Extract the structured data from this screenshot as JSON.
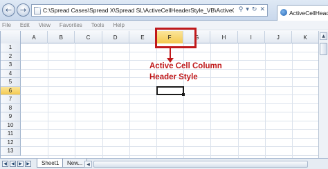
{
  "browser": {
    "url": "C:\\Spread Cases\\Spread X\\Spread SL\\ActiveCellHeaderStyle_VB\\ActiveCellHeaderStyle_\\",
    "tab_title": "ActiveCellHeader",
    "back_icon": "back-arrow-icon",
    "forward_icon": "forward-arrow-icon"
  },
  "menu": [
    "File",
    "Edit",
    "View",
    "Favorites",
    "Tools",
    "Help"
  ],
  "spreadsheet": {
    "columns": [
      "A",
      "B",
      "C",
      "D",
      "E",
      "F",
      "G",
      "H",
      "I",
      "J",
      "K"
    ],
    "rows": [
      "1",
      "2",
      "3",
      "4",
      "5",
      "6",
      "7",
      "8",
      "9",
      "10",
      "11",
      "12",
      "13"
    ],
    "active_column": "F",
    "active_row": "6",
    "active_cell": "F6",
    "header_highlight_color": "#f6d365"
  },
  "annotation": {
    "line1": "Active Cell Column",
    "line2": "Header Style",
    "color": "#c0191b"
  },
  "sheet_tabs": [
    "Sheet1",
    "New..."
  ]
}
